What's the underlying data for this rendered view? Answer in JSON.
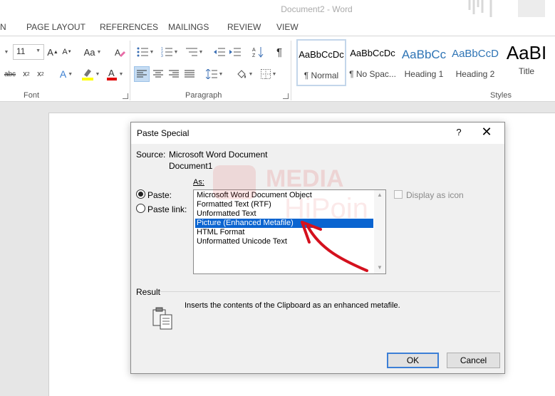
{
  "window": {
    "title": "Document2 - Word"
  },
  "tabs": [
    "N",
    "PAGE LAYOUT",
    "REFERENCES",
    "MAILINGS",
    "REVIEW",
    "VIEW"
  ],
  "ribbon": {
    "font_size": "11",
    "font_group_label": "Font",
    "paragraph_group_label": "Paragraph",
    "styles_group_label": "Styles",
    "styles": [
      {
        "sample": "AaBbCcDc",
        "label": "¶ Normal"
      },
      {
        "sample": "AaBbCcDc",
        "label": "¶ No Spac..."
      },
      {
        "sample": "AaBbCc",
        "label": "Heading 1"
      },
      {
        "sample": "AaBbCcD",
        "label": "Heading 2"
      },
      {
        "sample": "AaBI",
        "label": "Title"
      }
    ],
    "colors": {
      "highlight": "#ffff00",
      "font_color": "#e00000",
      "accent": "#2b579a"
    }
  },
  "dialog": {
    "title": "Paste Special",
    "help": "?",
    "close": "✕",
    "source_label": "Source:",
    "source_line1": "Microsoft Word Document",
    "source_line2": "Document1",
    "as_label": "As:",
    "paste_label": "Paste:",
    "paste_link_label": "Paste link:",
    "paste_selected": true,
    "options": [
      "Microsoft Word Document Object",
      "Formatted Text (RTF)",
      "Unformatted Text",
      "Picture (Enhanced Metafile)",
      "HTML Format",
      "Unformatted Unicode Text"
    ],
    "selected_index": 3,
    "display_as_icon": "Display as icon",
    "result_label": "Result",
    "result_text": "Inserts the contents of the Clipboard as an enhanced metafile.",
    "ok": "OK",
    "cancel": "Cancel"
  },
  "watermark": {
    "line1": "MEDIA",
    "line2": "HiPoin"
  }
}
